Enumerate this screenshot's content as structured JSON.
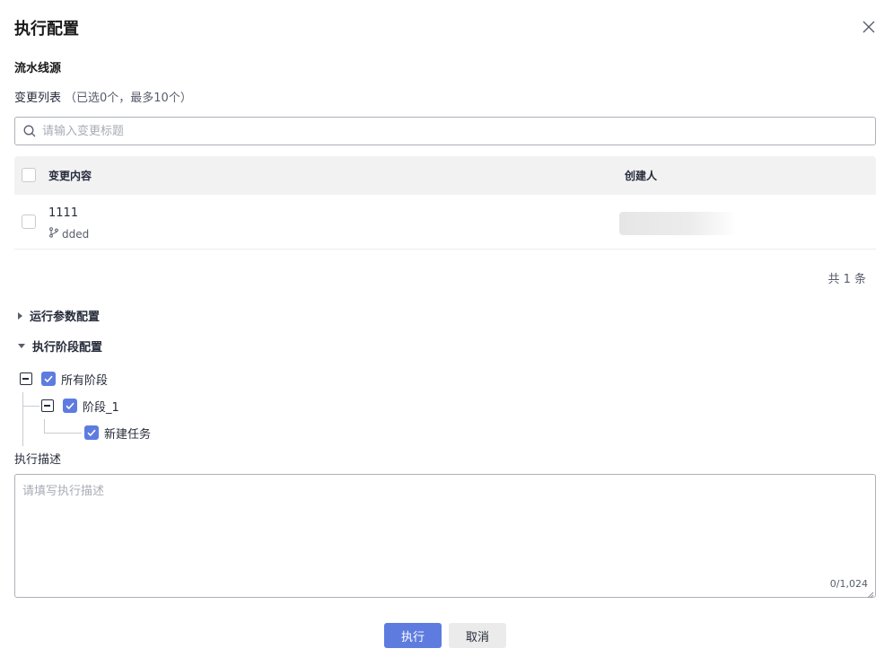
{
  "dialog": {
    "title": "执行配置",
    "section_title": "流水线源",
    "change_list_label": "变更列表",
    "change_list_hint": "（已选0个，最多10个）",
    "search": {
      "placeholder": "请输入变更标题",
      "value": "",
      "icon": "search-icon"
    },
    "table": {
      "columns": [
        "变更内容",
        "创建人"
      ],
      "rows": [
        {
          "title": "1111",
          "branch": "dded",
          "branch_icon": "branch-icon",
          "creator": ""
        }
      ]
    },
    "pagination": {
      "total_text": "共 1 条"
    },
    "collapses": [
      {
        "label": "运行参数配置",
        "expanded": false
      },
      {
        "label": "执行阶段配置",
        "expanded": true
      }
    ],
    "stage_tree": {
      "root": {
        "label": "所有阶段",
        "checked": true
      },
      "stage": {
        "label": "阶段_1",
        "checked": true
      },
      "task": {
        "label": "新建任务",
        "checked": true
      }
    },
    "description": {
      "label": "执行描述",
      "placeholder": "请填写执行描述",
      "value": "",
      "counter": "0/1,024"
    },
    "buttons": {
      "execute": "执行",
      "cancel": "取消"
    },
    "colors": {
      "primary": "#5e7ce0",
      "header_bg": "#f2f2f3",
      "border": "#adb0b8"
    }
  }
}
